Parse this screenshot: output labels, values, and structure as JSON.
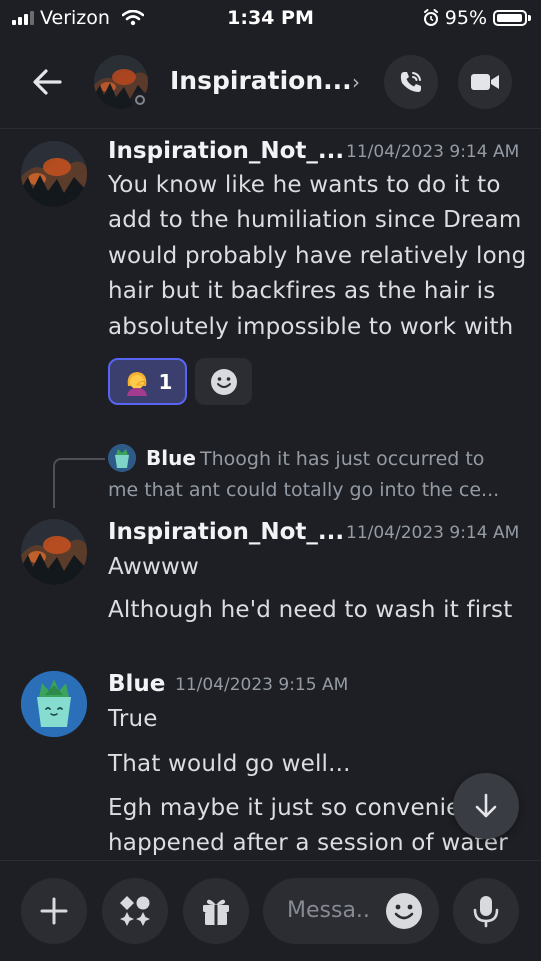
{
  "status_bar": {
    "carrier": "Verizon",
    "time": "1:34 PM",
    "battery": "95%"
  },
  "header": {
    "title": "Inspiration...",
    "chevron": "›"
  },
  "messages": [
    {
      "author": "Inspiration_Not_...",
      "timestamp": "11/04/2023 9:14 AM",
      "lines": [
        "You know like he wants to do it to",
        "add to the humiliation since Dream",
        "would probably have relatively long",
        "hair but it backfires as the hair is",
        "absolutely impossible to work with"
      ],
      "reaction": {
        "count": "1"
      }
    },
    {
      "reply": {
        "author": "Blue",
        "text_line1": "Thoogh it has just occurred to",
        "text_line2": "me that ant could totally go into the ce..."
      },
      "author": "Inspiration_Not_...",
      "timestamp": "11/04/2023 9:14 AM",
      "lines": [
        "Awwww",
        "Although he'd need to wash it first"
      ]
    },
    {
      "author": "Blue",
      "timestamp": "11/04/2023 9:15 AM",
      "lines": [
        "True",
        "That would go well...",
        "Egh maybe it just so convenier",
        "happened after a session of water"
      ]
    }
  ],
  "composer": {
    "placeholder": "Messa.."
  },
  "colors": {
    "background": "#1e1f24",
    "accent": "#5865f2",
    "surface": "#2b2d33"
  }
}
